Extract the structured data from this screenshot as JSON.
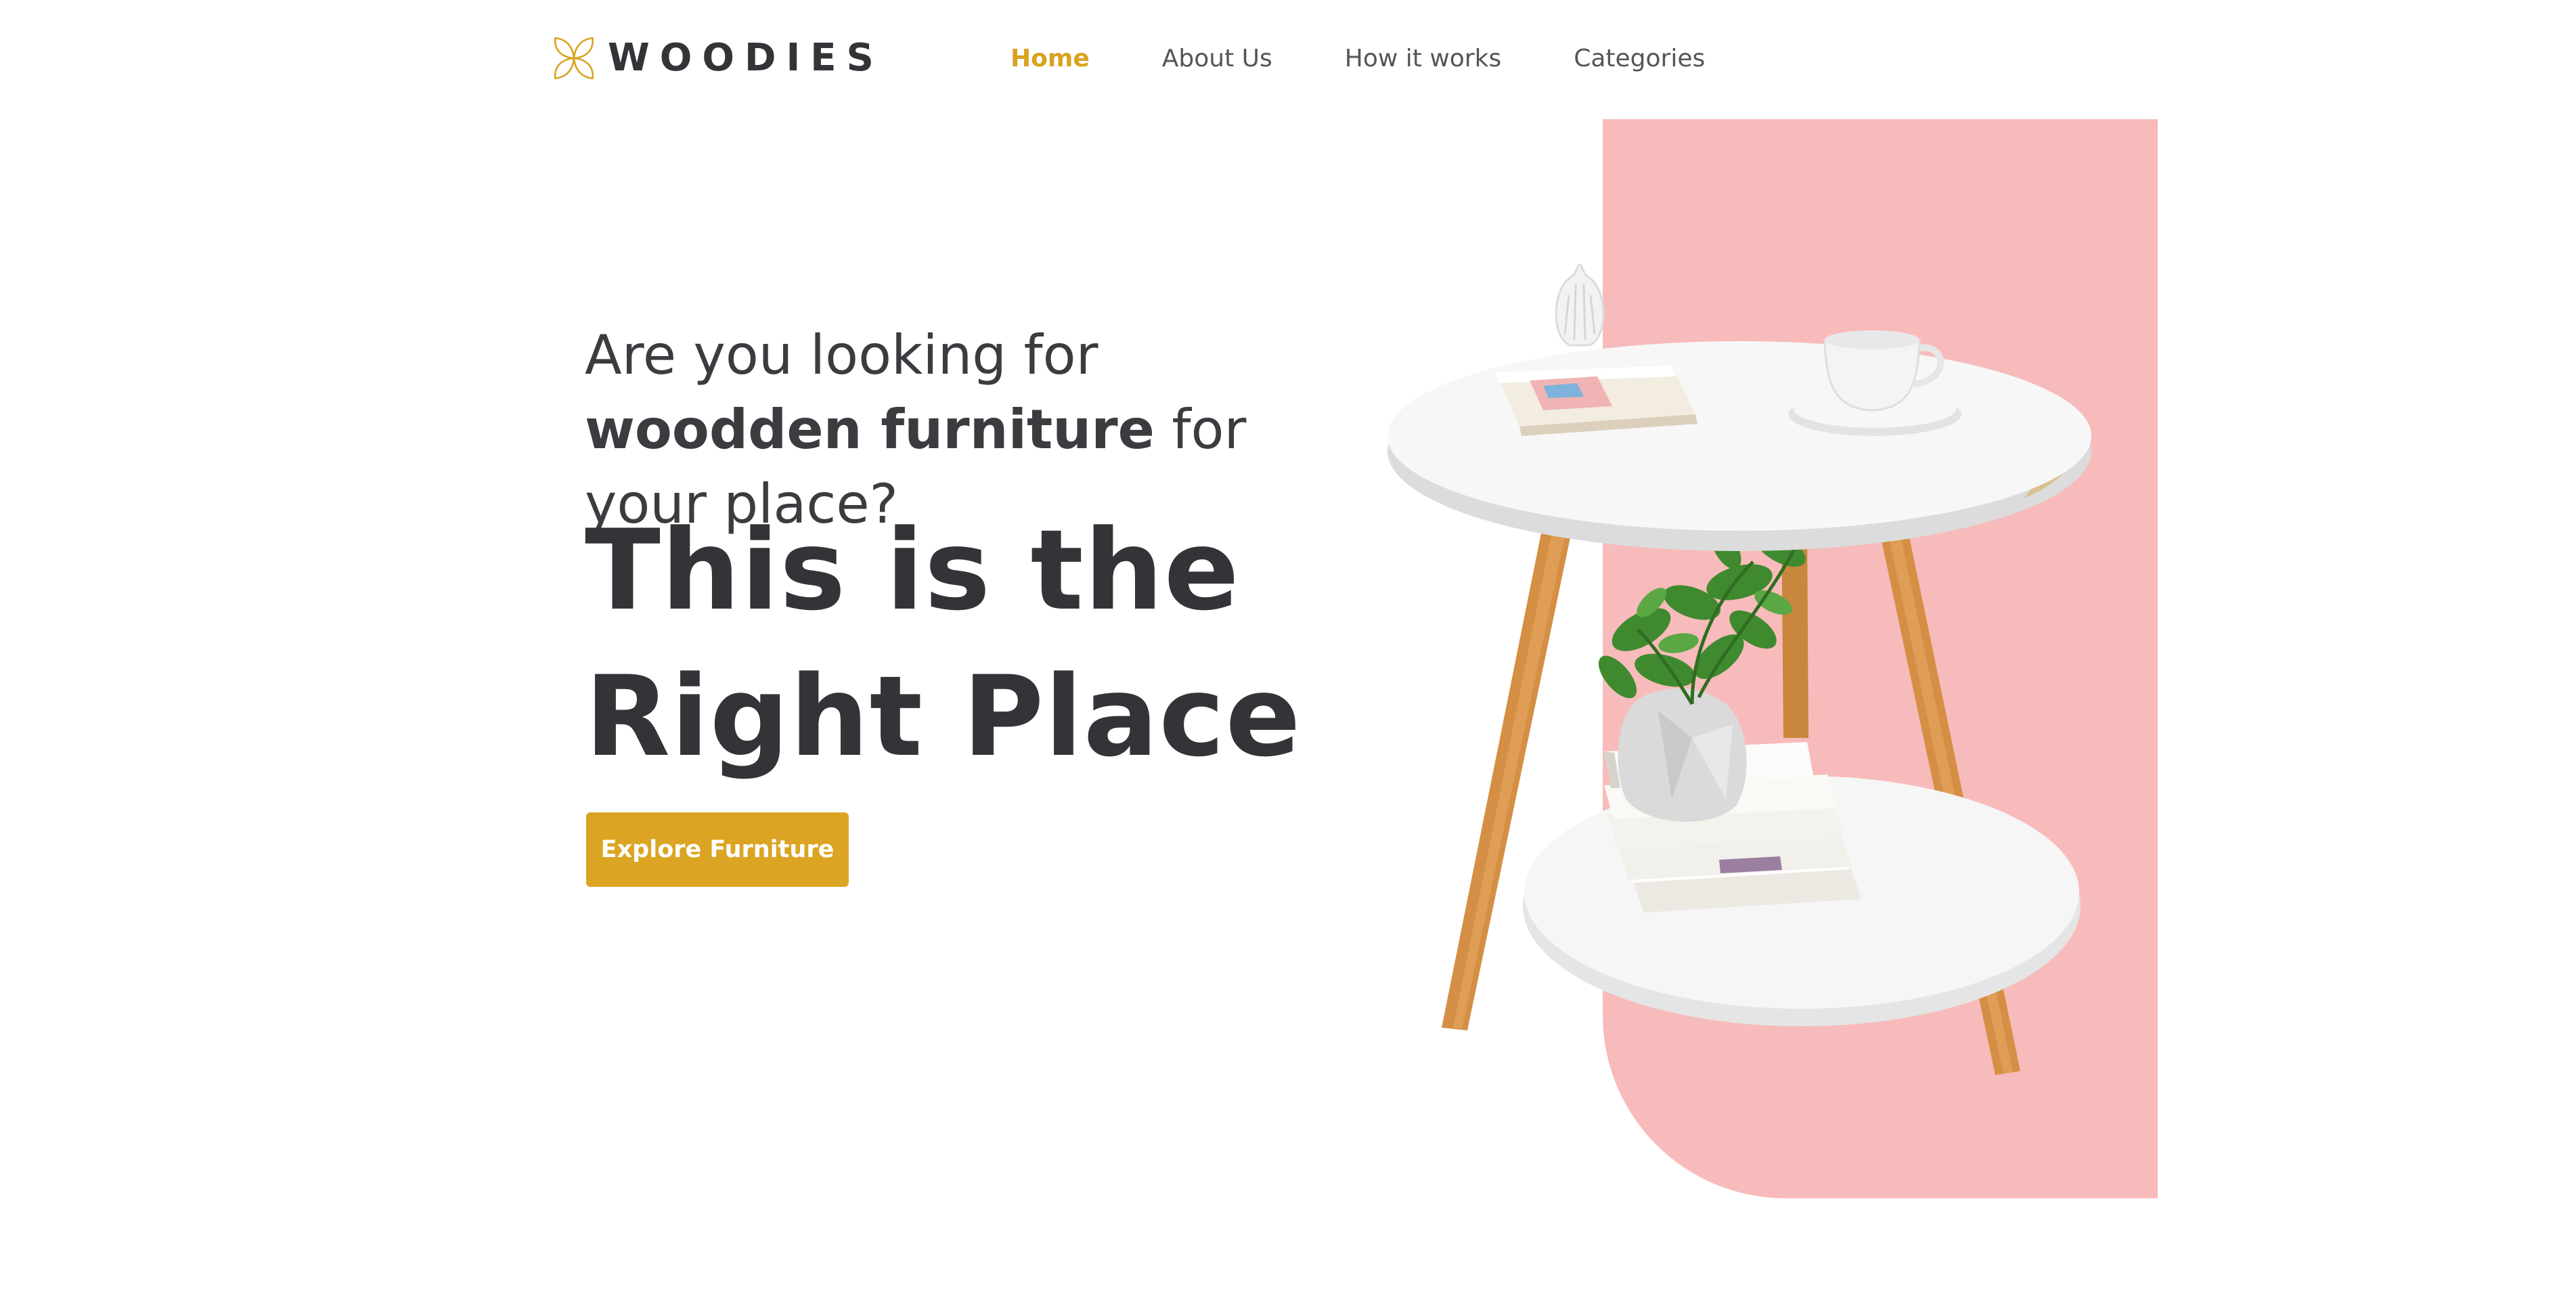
{
  "brand": {
    "name": "WOODIES",
    "logo_icon": "four-petal-flower-icon",
    "accent_color": "#dba523"
  },
  "nav": {
    "items": [
      {
        "label": "Home",
        "active": true
      },
      {
        "label": "About Us",
        "active": false
      },
      {
        "label": "How it works",
        "active": false
      },
      {
        "label": "Categories",
        "active": false
      }
    ]
  },
  "hero": {
    "subtitle_part1": "Are you looking for ",
    "subtitle_bold": "woodden furniture",
    "subtitle_part2": " for your place?",
    "title_line1": "This is the",
    "title_line2": "Right Place",
    "cta_label": "Explore Furniture",
    "panel_color": "#f8bbbb",
    "image": "side-table-with-plant-books-and-cup"
  }
}
